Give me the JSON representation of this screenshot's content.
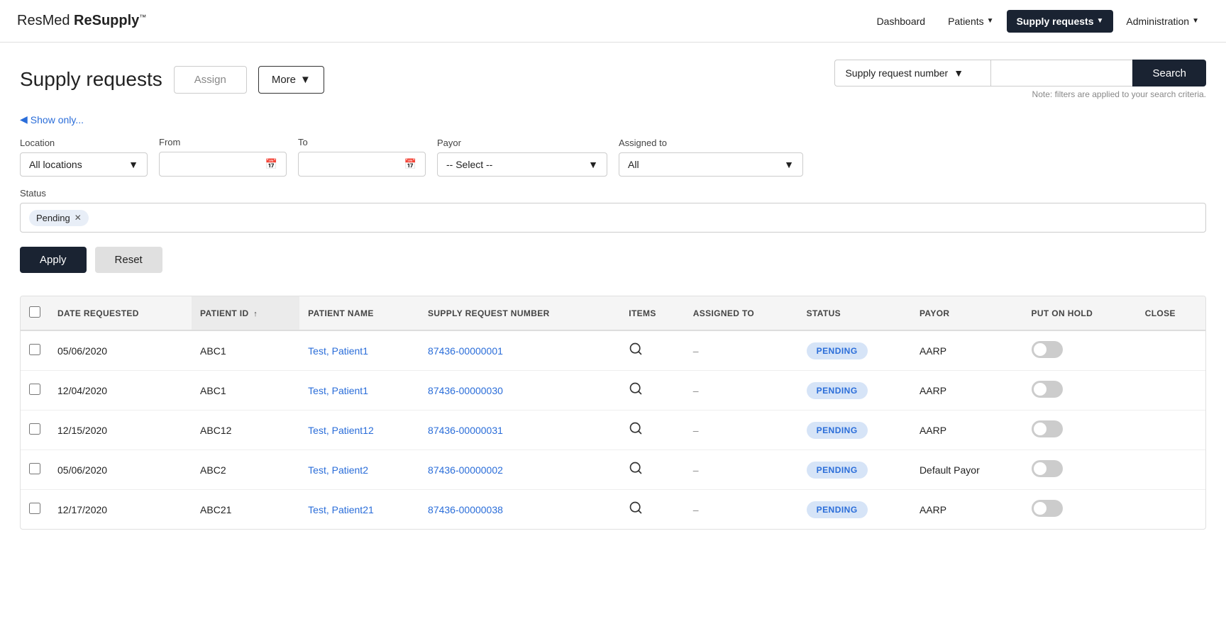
{
  "brand": {
    "name_regular": "ResMed ",
    "name_bold": "ReSupply",
    "trademark": "™"
  },
  "nav": {
    "items": [
      {
        "label": "Dashboard",
        "active": false,
        "has_dropdown": false
      },
      {
        "label": "Patients",
        "active": false,
        "has_dropdown": true
      },
      {
        "label": "Supply requests",
        "active": true,
        "has_dropdown": true
      },
      {
        "label": "Administration",
        "active": false,
        "has_dropdown": true
      }
    ]
  },
  "page": {
    "title": "Supply requests",
    "assign_label": "Assign",
    "more_label": "More",
    "search_note": "Note: filters are applied to your search criteria.",
    "search_placeholder": "",
    "search_select_label": "Supply request number",
    "search_button_label": "Search"
  },
  "filters": {
    "show_only_label": "Show only...",
    "location_label": "Location",
    "location_value": "All locations",
    "from_label": "From",
    "to_label": "To",
    "payor_label": "Payor",
    "payor_value": "-- Select --",
    "assigned_label": "Assigned to",
    "assigned_value": "All",
    "status_label": "Status",
    "status_tag": "Pending",
    "apply_label": "Apply",
    "reset_label": "Reset"
  },
  "table": {
    "columns": [
      {
        "key": "date_requested",
        "label": "Date Requested",
        "sortable": false
      },
      {
        "key": "patient_id",
        "label": "Patient ID",
        "sortable": true
      },
      {
        "key": "patient_name",
        "label": "Patient Name",
        "sortable": false
      },
      {
        "key": "supply_request_number",
        "label": "Supply Request Number",
        "sortable": false
      },
      {
        "key": "items",
        "label": "Items",
        "sortable": false
      },
      {
        "key": "assigned_to",
        "label": "Assigned To",
        "sortable": false
      },
      {
        "key": "status",
        "label": "Status",
        "sortable": false
      },
      {
        "key": "payor",
        "label": "Payor",
        "sortable": false
      },
      {
        "key": "put_on_hold",
        "label": "Put On Hold",
        "sortable": false
      },
      {
        "key": "close",
        "label": "Close",
        "sortable": false
      }
    ],
    "rows": [
      {
        "date_requested": "05/06/2020",
        "patient_id": "ABC1",
        "patient_name": "Test, Patient1",
        "supply_request_number": "87436-00000001",
        "items": "search",
        "assigned_to": "–",
        "status": "PENDING",
        "payor": "AARP",
        "put_on_hold": false,
        "close": false
      },
      {
        "date_requested": "12/04/2020",
        "patient_id": "ABC1",
        "patient_name": "Test, Patient1",
        "supply_request_number": "87436-00000030",
        "items": "search",
        "assigned_to": "–",
        "status": "PENDING",
        "payor": "AARP",
        "put_on_hold": false,
        "close": false
      },
      {
        "date_requested": "12/15/2020",
        "patient_id": "ABC12",
        "patient_name": "Test, Patient12",
        "supply_request_number": "87436-00000031",
        "items": "search",
        "assigned_to": "–",
        "status": "PENDING",
        "payor": "AARP",
        "put_on_hold": false,
        "close": false
      },
      {
        "date_requested": "05/06/2020",
        "patient_id": "ABC2",
        "patient_name": "Test, Patient2",
        "supply_request_number": "87436-00000002",
        "items": "search",
        "assigned_to": "–",
        "status": "PENDING",
        "payor": "Default Payor",
        "put_on_hold": false,
        "close": false
      },
      {
        "date_requested": "12/17/2020",
        "patient_id": "ABC21",
        "patient_name": "Test, Patient21",
        "supply_request_number": "87436-00000038",
        "items": "search",
        "assigned_to": "–",
        "status": "PENDING",
        "payor": "AARP",
        "put_on_hold": false,
        "close": false
      }
    ]
  }
}
